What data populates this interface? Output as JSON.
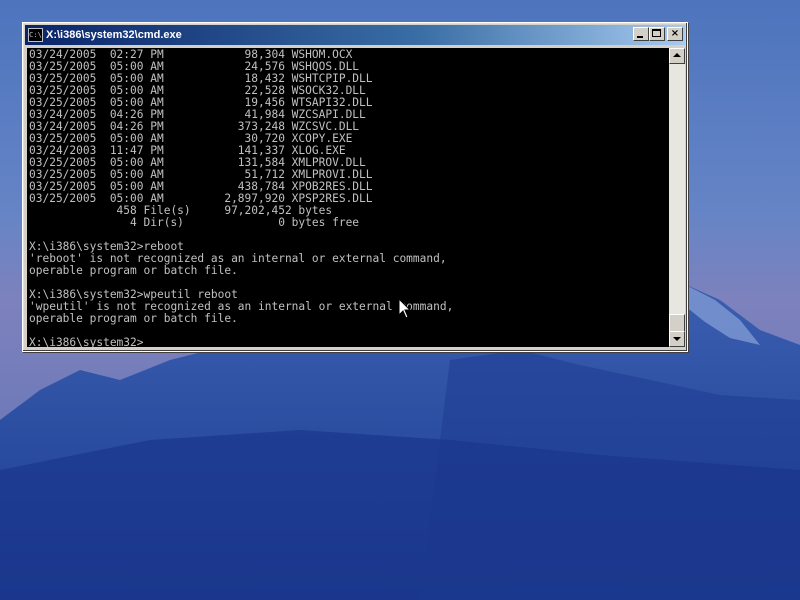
{
  "window": {
    "title": "X:\\i386\\system32\\cmd.exe",
    "icon_label": "C:\\",
    "buttons": {
      "minimize": "minimize-icon",
      "maximize": "maximize-icon",
      "close": "×"
    }
  },
  "console": {
    "lines": [
      "03/24/2005  02:27 PM            98,304 WSHOM.OCX",
      "03/25/2005  05:00 AM            24,576 WSHQOS.DLL",
      "03/25/2005  05:00 AM            18,432 WSHTCPIP.DLL",
      "03/25/2005  05:00 AM            22,528 WSOCK32.DLL",
      "03/25/2005  05:00 AM            19,456 WTSAPI32.DLL",
      "03/24/2005  04:26 PM            41,984 WZCSAPI.DLL",
      "03/24/2005  04:26 PM           373,248 WZCSVC.DLL",
      "03/25/2005  05:00 AM            30,720 XCOPY.EXE",
      "03/24/2003  11:47 PM           141,337 XLOG.EXE",
      "03/25/2005  05:00 AM           131,584 XMLPROV.DLL",
      "03/25/2005  05:00 AM            51,712 XMLPROVI.DLL",
      "03/25/2005  05:00 AM           438,784 XPOB2RES.DLL",
      "03/25/2005  05:00 AM         2,897,920 XPSP2RES.DLL",
      "             458 File(s)     97,202,452 bytes",
      "               4 Dir(s)              0 bytes free",
      "",
      "X:\\i386\\system32>reboot",
      "'reboot' is not recognized as an internal or external command,",
      "operable program or batch file.",
      "",
      "X:\\i386\\system32>wpeutil reboot",
      "'wpeutil' is not recognized as an internal or external command,",
      "operable program or batch file.",
      "",
      "X:\\i386\\system32>"
    ]
  },
  "colors": {
    "console_bg": "#000000",
    "console_text": "#c0c0c0",
    "titlebar_start": "#0a246a",
    "titlebar_end": "#a6caf0"
  }
}
